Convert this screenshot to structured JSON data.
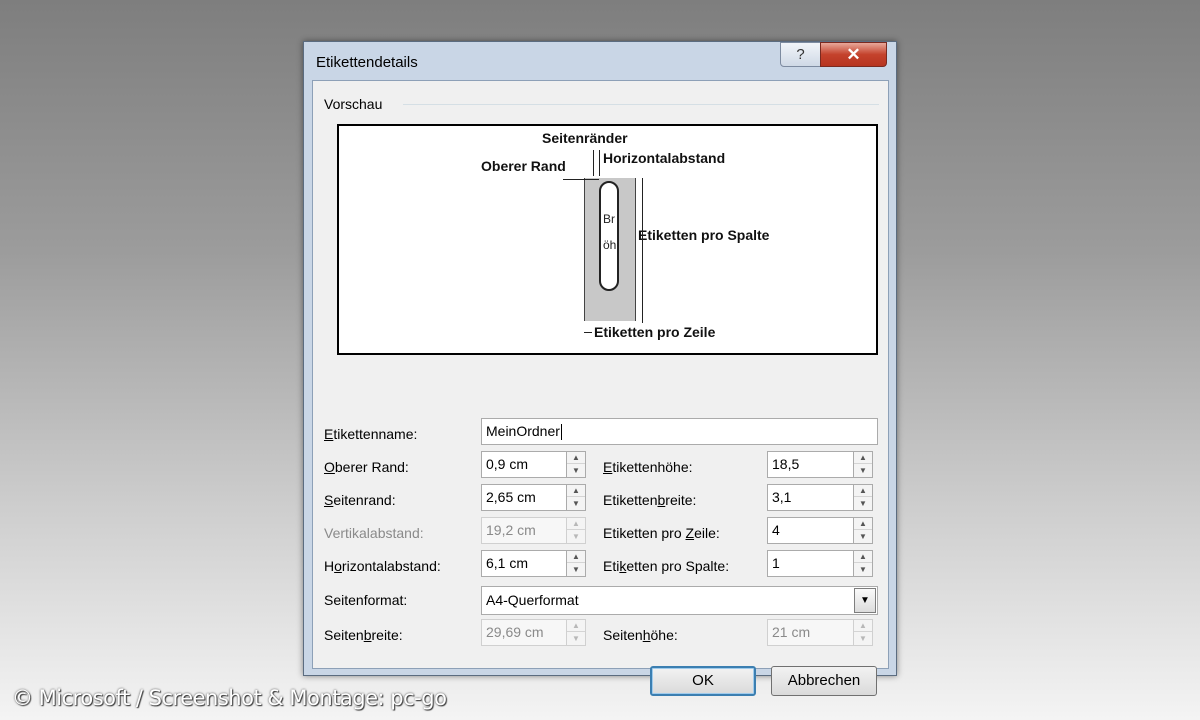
{
  "dialog": {
    "title": "Etikettendetails",
    "help_label": "?",
    "close_label": "✕"
  },
  "preview": {
    "group_label": "Vorschau",
    "labels": {
      "seitenraender": "Seitenränder",
      "oberer_rand": "Oberer Rand",
      "horizontalabstand": "Horizontalabstand",
      "etiketten_pro_spalte": "Etiketten pro Spalte",
      "etiketten_pro_zeile": "Etiketten pro Zeile",
      "breite_fragment": "Br",
      "hoehe_fragment": "öh"
    }
  },
  "form": {
    "etikettenname": {
      "label_pre": "",
      "label_u": "E",
      "label_post": "tikettenname:",
      "value": "MeinOrdner"
    },
    "oberer_rand": {
      "label_pre": "",
      "label_u": "O",
      "label_post": "berer Rand:",
      "value": "0,9 cm"
    },
    "seitenrand": {
      "label_pre": "",
      "label_u": "S",
      "label_post": "eitenrand:",
      "value": "2,65 cm"
    },
    "vertikalabstand": {
      "label": "Vertikalabstand:",
      "value": "19,2 cm"
    },
    "horizontalabstand": {
      "label_pre": "H",
      "label_u": "o",
      "label_post": "rizontalabstand:",
      "value": "6,1 cm"
    },
    "etikettenhoehe": {
      "label_pre": "",
      "label_u": "E",
      "label_post": "tikettenhöhe:",
      "value": "18,5"
    },
    "etikettenbreite": {
      "label_pre": "Etiketten",
      "label_u": "b",
      "label_post": "reite:",
      "value": "3,1"
    },
    "etiketten_pro_zeile": {
      "label_pre": "Etiketten pro ",
      "label_u": "Z",
      "label_post": "eile:",
      "value": "4"
    },
    "etiketten_pro_spalte": {
      "label_pre": "Eti",
      "label_u": "k",
      "label_post": "etten pro Spalte:",
      "value": "1"
    },
    "seitenformat": {
      "label": "Seitenformat:",
      "value": "A4-Querformat"
    },
    "seitenbreite": {
      "label_pre": "Seiten",
      "label_u": "b",
      "label_post": "reite:",
      "value": "29,69 cm"
    },
    "seitenhoehe": {
      "label_pre": "Seiten",
      "label_u": "h",
      "label_post": "öhe:",
      "value": "21 cm"
    }
  },
  "buttons": {
    "ok": "OK",
    "cancel": "Abbrechen"
  },
  "credit": "© Microsoft / Screenshot & Montage: pc-go"
}
